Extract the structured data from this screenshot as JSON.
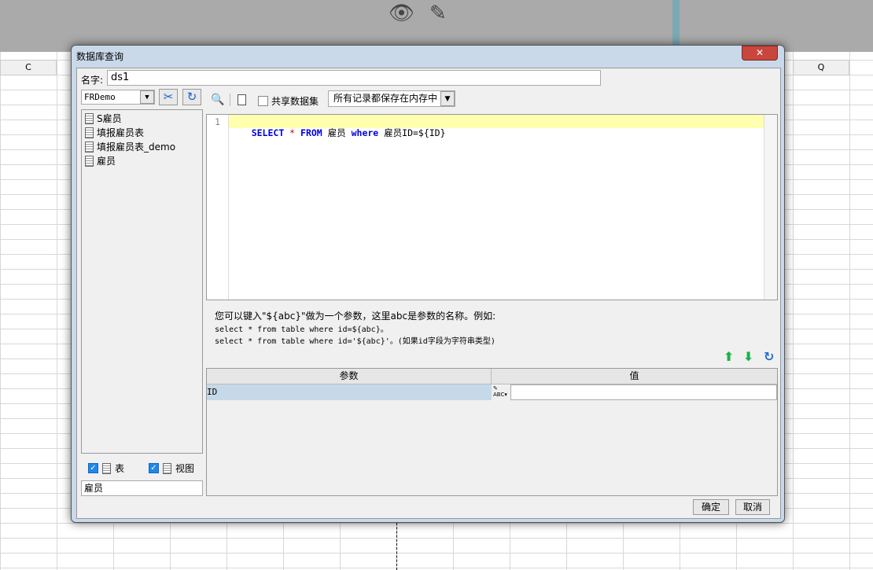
{
  "background": {
    "columns": [
      "C",
      "Q"
    ],
    "icons": [
      "eye-slash-icon",
      "pencil-icon"
    ]
  },
  "dialog": {
    "title": "数据库查询",
    "close_label": "✕",
    "name_label": "名字:",
    "name_value": "ds1",
    "connection": "FRDemo",
    "tables": [
      "S雇员",
      "填报雇员表",
      "填报雇员表_demo",
      "雇员"
    ],
    "show_table_label": "表",
    "show_view_label": "视图",
    "filter_value": "雇员",
    "share_label": "共享数据集",
    "memory_option": "所有记录都保存在内存中",
    "sql": {
      "line_no": "1",
      "kw1": "SELECT",
      "star": " * ",
      "kw2": "FROM",
      "t1": " 雇员 ",
      "kw3": "where",
      "t2": " 雇员ID=${ID}"
    },
    "hint": {
      "line1": "您可以键入\"${abc}\"做为一个参数，这里abc是参数的名称。例如:",
      "line2": "select * from table where id=${abc}。",
      "line3": "select * from table where id='${abc}'。(如果id字段为字符串类型)"
    },
    "params": {
      "headers": [
        "参数",
        "值"
      ],
      "rows": [
        {
          "name": "ID",
          "value": ""
        }
      ]
    },
    "ok_label": "确定",
    "cancel_label": "取消"
  }
}
